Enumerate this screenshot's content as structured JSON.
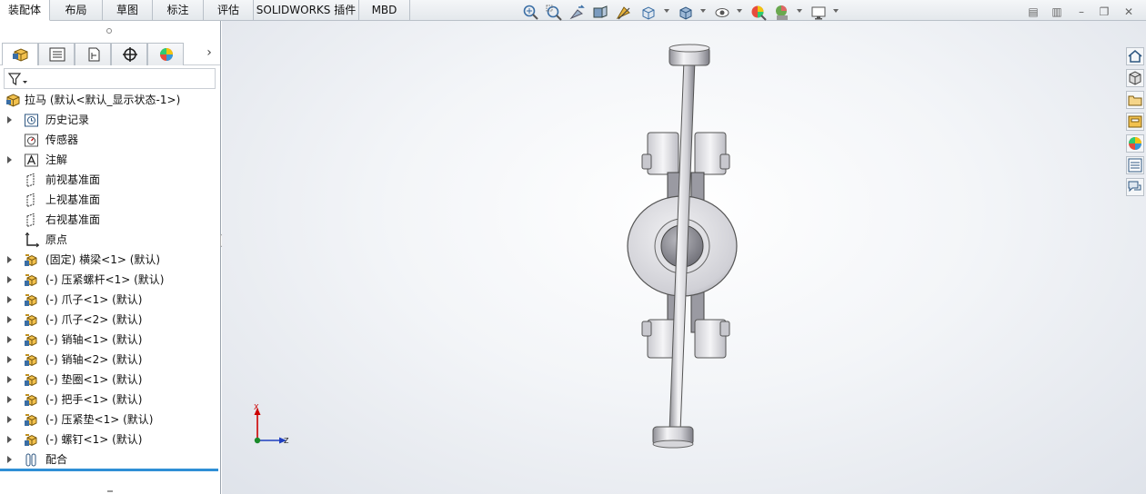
{
  "tabs": [
    {
      "label": "装配体",
      "active": true
    },
    {
      "label": "布局",
      "active": false
    },
    {
      "label": "草图",
      "active": false
    },
    {
      "label": "标注",
      "active": false
    },
    {
      "label": "评估",
      "active": false
    },
    {
      "label": "SOLIDWORKS 插件",
      "active": false
    },
    {
      "label": "MBD",
      "active": false
    }
  ],
  "view_toolbar": {
    "icons": [
      "zoom-to-fit-icon",
      "zoom-to-area-icon",
      "previous-view-icon",
      "section-view-icon",
      "dynamic-annotation-icon",
      "view-orientation-icon",
      "display-style-icon",
      "hide-show-items-icon",
      "edit-appearance-icon",
      "apply-scene-icon",
      "view-settings-icon"
    ]
  },
  "panel": {
    "tabs": [
      "featuremanager-tab",
      "propertymanager-tab",
      "configurationmanager-tab",
      "dimxpert-tab",
      "display-manager-tab"
    ],
    "root": {
      "label": "拉马 (默认<默认_显示状态-1>)",
      "icon": "assembly-icon"
    },
    "tree": [
      {
        "label": "历史记录",
        "icon": "history-icon",
        "expandable": true
      },
      {
        "label": "传感器",
        "icon": "sensor-icon",
        "expandable": false
      },
      {
        "label": "注解",
        "icon": "annotation-icon",
        "expandable": true
      },
      {
        "label": "前视基准面",
        "icon": "plane-icon",
        "expandable": false
      },
      {
        "label": "上视基准面",
        "icon": "plane-icon",
        "expandable": false
      },
      {
        "label": "右视基准面",
        "icon": "plane-icon",
        "expandable": false
      },
      {
        "label": "原点",
        "icon": "origin-icon",
        "expandable": false
      },
      {
        "label": "(固定) 横梁<1> (默认)",
        "icon": "part-icon",
        "expandable": true
      },
      {
        "label": "(-) 压紧螺杆<1> (默认)",
        "icon": "part-icon",
        "expandable": true
      },
      {
        "label": "(-) 爪子<1> (默认)",
        "icon": "part-icon",
        "expandable": true
      },
      {
        "label": "(-) 爪子<2> (默认)",
        "icon": "part-icon",
        "expandable": true
      },
      {
        "label": "(-) 销轴<1> (默认)",
        "icon": "part-icon",
        "expandable": true
      },
      {
        "label": "(-) 销轴<2> (默认)",
        "icon": "part-icon",
        "expandable": true
      },
      {
        "label": "(-) 垫圈<1> (默认)",
        "icon": "part-icon",
        "expandable": true
      },
      {
        "label": "(-) 把手<1> (默认)",
        "icon": "part-icon",
        "expandable": true
      },
      {
        "label": "(-) 压紧垫<1> (默认)",
        "icon": "part-icon",
        "expandable": true
      },
      {
        "label": "(-) 螺钉<1> (默认)",
        "icon": "part-icon",
        "expandable": true
      },
      {
        "label": "配合",
        "icon": "mates-icon",
        "expandable": true
      }
    ]
  },
  "triad": {
    "x_label": "X",
    "z_label": "Z"
  },
  "task_pane": [
    "home-icon",
    "3d-parts-icon",
    "file-explorer-icon",
    "view-palette-icon",
    "appearances-icon",
    "custom-properties-icon",
    "forum-icon"
  ],
  "colors": {
    "selection_blue": "#2f8fd6",
    "axis_x": "#cc0000",
    "axis_z": "#1f3fbf",
    "model_gray": "#d8d8dc"
  }
}
